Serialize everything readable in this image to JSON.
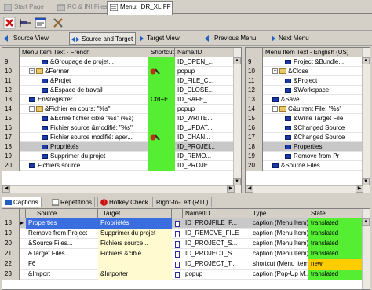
{
  "tabs": [
    {
      "label": "Start Page",
      "state": "inactive"
    },
    {
      "label": "RC & INI Files*",
      "state": "inactive"
    },
    {
      "label": "Menu: IDR_XLIFF",
      "state": "active"
    }
  ],
  "viewbar": {
    "source_view": "Source View",
    "source_and_target": "Source and Target",
    "target_view": "Target View",
    "previous_menu": "Previous Menu",
    "next_menu": "Next Menu"
  },
  "left_table": {
    "columns": [
      "Menu Item Text - French",
      "Shortcut",
      "Name/ID"
    ],
    "rows": [
      {
        "num": "9",
        "text": "&Groupage de projet...",
        "shortcut": "",
        "id": "ID_OPEN_...",
        "kind": "item",
        "indent": 3
      },
      {
        "num": "10",
        "text": "&Fermer",
        "shortcut": "",
        "id": "popup",
        "kind": "folder",
        "indent": 1
      },
      {
        "num": "11",
        "text": "&Projet",
        "shortcut": "",
        "id": "ID_FILE_C...",
        "kind": "item",
        "indent": 3
      },
      {
        "num": "12",
        "text": "&Espace de travail",
        "shortcut": "",
        "id": "ID_CLOSE...",
        "kind": "item",
        "indent": 3
      },
      {
        "num": "13",
        "text": "En&registrer",
        "shortcut": "Ctrl+E",
        "id": "ID_SAFE_...",
        "kind": "item",
        "indent": 1
      },
      {
        "num": "14",
        "text": "&Fichier en cours: \"%s\"",
        "shortcut": "",
        "id": "popup",
        "kind": "folder",
        "indent": 1
      },
      {
        "num": "15",
        "text": "&Écrire fichier cible \"%s\" (%s)",
        "shortcut": "",
        "id": "ID_WRITE...",
        "kind": "item",
        "indent": 3
      },
      {
        "num": "16",
        "text": "Fichier source &modifié: \"%s\"",
        "shortcut": "",
        "id": "ID_UPDAT...",
        "kind": "item",
        "indent": 3
      },
      {
        "num": "17",
        "text": "Fichier source modifié: aper...",
        "shortcut": "",
        "id": "ID_CHAN...",
        "kind": "item",
        "indent": 3
      },
      {
        "num": "18",
        "text": "Propriétés",
        "shortcut": "",
        "id": "ID_PROJEI...",
        "kind": "item",
        "indent": 3
      },
      {
        "num": "19",
        "text": "Supprimer du projet",
        "shortcut": "",
        "id": "ID_REMO...",
        "kind": "item",
        "indent": 3
      },
      {
        "num": "20",
        "text": "Fichiers source...",
        "shortcut": "",
        "id": "ID_PROJE...",
        "kind": "item",
        "indent": 1
      }
    ]
  },
  "right_table": {
    "columns": [
      "Menu Item Text - English (US)"
    ],
    "rows": [
      {
        "num": "9",
        "text": "Project &Bundle...",
        "kind": "item",
        "indent": 3
      },
      {
        "num": "10",
        "text": "&Close",
        "kind": "folder",
        "indent": 1
      },
      {
        "num": "11",
        "text": "&Project",
        "kind": "item",
        "indent": 3
      },
      {
        "num": "12",
        "text": "&Workspace",
        "kind": "item",
        "indent": 3
      },
      {
        "num": "13",
        "text": "&Save",
        "kind": "item",
        "indent": 1
      },
      {
        "num": "14",
        "text": "C&urrent File: \"%s\"",
        "kind": "folder",
        "indent": 1
      },
      {
        "num": "15",
        "text": "&Write Target File",
        "kind": "item",
        "indent": 3
      },
      {
        "num": "16",
        "text": "&Changed Source",
        "kind": "item",
        "indent": 3
      },
      {
        "num": "17",
        "text": "&Changed Source",
        "kind": "item",
        "indent": 3
      },
      {
        "num": "18",
        "text": "Properties",
        "kind": "item",
        "indent": 3
      },
      {
        "num": "19",
        "text": "Remove from Pr",
        "kind": "item",
        "indent": 3
      },
      {
        "num": "20",
        "text": "&Source Files...",
        "kind": "item",
        "indent": 1
      }
    ]
  },
  "bottom_tabs": [
    "Captions",
    "Repetitions",
    "Hotkey Check",
    "Right-to-Left (RTL)"
  ],
  "grid": {
    "columns": [
      "Source",
      "Target",
      "Name/ID",
      "Type",
      "State"
    ],
    "rows": [
      {
        "num": "18",
        "source": "Properties",
        "target": "Propriétés",
        "id": "ID_PROJFILE_P...",
        "type": "caption (Menu Item)",
        "state": "translated",
        "selected": true
      },
      {
        "num": "19",
        "source": "Remove from Project",
        "target": "Supprimer du projet",
        "id": "ID_REMOVE_FILE",
        "type": "caption (Menu Item)",
        "state": "translated",
        "selected": false
      },
      {
        "num": "20",
        "source": "&Source Files...",
        "target": "Fichiers source...",
        "id": "ID_PROJECT_S...",
        "type": "caption (Menu Item)",
        "state": "translated",
        "selected": false
      },
      {
        "num": "21",
        "source": "&Target Files...",
        "target": "Fichiers &cible...",
        "id": "ID_PROJECT_S...",
        "type": "caption (Menu Item)",
        "state": "translated",
        "selected": false
      },
      {
        "num": "22",
        "source": "F6",
        "target": "",
        "id": "ID_PROJECT_T...",
        "type": "shortcut (Menu Item)",
        "state": "new",
        "selected": false
      },
      {
        "num": "23",
        "source": "&Import",
        "target": "&Importer",
        "id": "popup",
        "type": "caption (Pop-Up M...",
        "state": "translated",
        "selected": false
      }
    ]
  },
  "colors": {
    "translated": "#55ee33",
    "new": "#ffcc00",
    "selection": "#c8c8c8"
  }
}
